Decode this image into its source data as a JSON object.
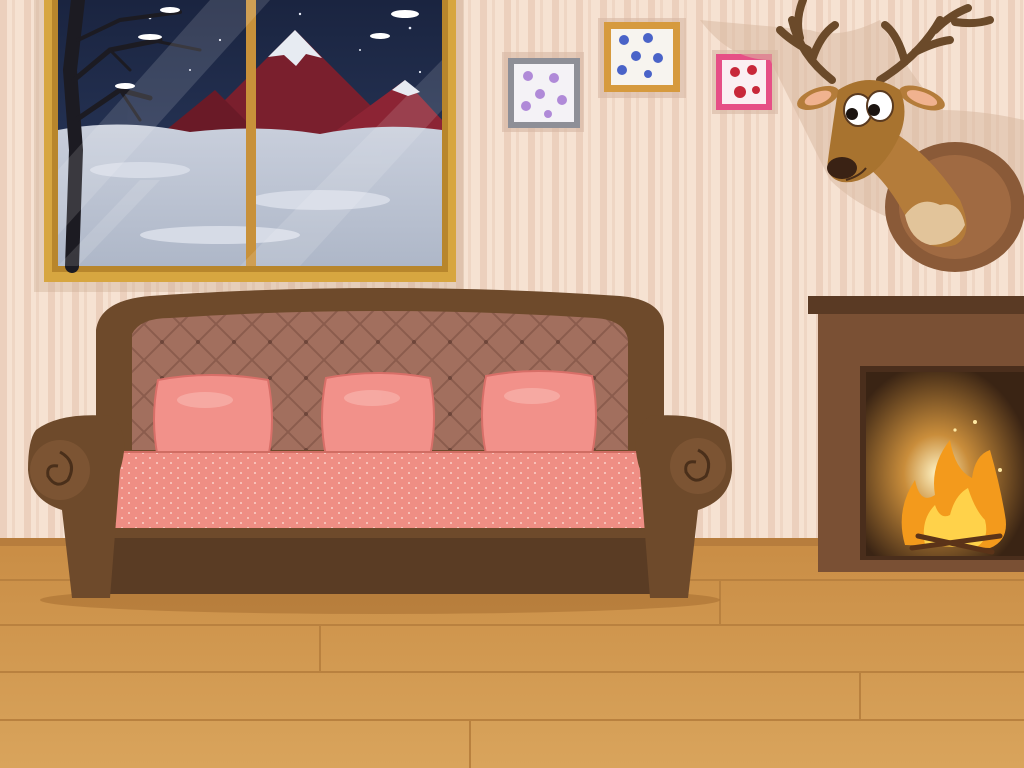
{
  "scene": {
    "kind": "illustrated-interior",
    "room": "living-room",
    "time_of_day": "night",
    "objects": [
      {
        "id": "window",
        "icon": "winter-window"
      },
      {
        "id": "picture-frames",
        "count": 3,
        "icon": "flower-picture-frame"
      },
      {
        "id": "deer-trophy",
        "icon": "deer-head-icon"
      },
      {
        "id": "sofa",
        "cushions": 3,
        "icon": "sofa-icon"
      },
      {
        "id": "fireplace",
        "lit": true,
        "icon": "fire-icon"
      }
    ]
  },
  "palette": {
    "wall_stripe_light": "#f6e2d2",
    "wall_stripe_dark": "#ecd0bd",
    "floor_wood": "#d29a52",
    "sofa_brown": "#6e4a2b",
    "cushion_pink": "#f2918a",
    "window_frame_gold": "#d7a640",
    "night_sky": "#1e2a4a",
    "fire_orange": "#f39a1c"
  }
}
